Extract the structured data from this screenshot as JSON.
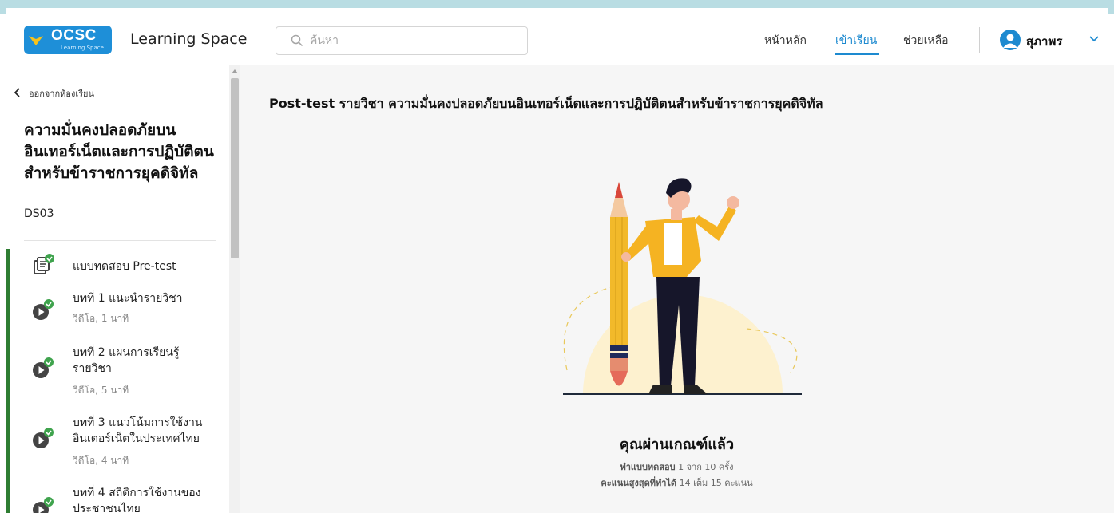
{
  "header": {
    "logo_text": "OCSC",
    "logo_sub": "Learning Space",
    "app_title": "Learning Space",
    "search_placeholder": "ค้นหา",
    "nav": [
      {
        "label": "หน้าหลัก",
        "active": false
      },
      {
        "label": "เข้าเรียน",
        "active": true
      },
      {
        "label": "ช่วยเหลือ",
        "active": false
      }
    ],
    "user_name": "สุภาพร",
    "accent_color": "#1d8ad0"
  },
  "sidebar": {
    "back_label": "ออกจากห้องเรียน",
    "course_title": "ความมั่นคงปลอดภัยบนอินเทอร์เน็ตและการปฏิบัติตนสำหรับข้าราชการยุคดิจิทัล",
    "course_code": "DS03",
    "items": [
      {
        "label": "แบบทดสอบ Pre-test",
        "meta": "",
        "type": "quiz",
        "completed": true
      },
      {
        "label": "บทที่ 1 แนะนำรายวิชา",
        "meta": "วีดีโอ, 1 นาที",
        "type": "video",
        "completed": true
      },
      {
        "label": "บทที่ 2 แผนการเรียนรู้รายวิชา",
        "meta": "วีดีโอ, 5 นาที",
        "type": "video",
        "completed": true
      },
      {
        "label": "บทที่ 3 แนวโน้มการใช้งานอินเตอร์เน็ตในประเทศไทย",
        "meta": "วีดีโอ, 4 นาที",
        "type": "video",
        "completed": true
      },
      {
        "label": "บทที่ 4 สถิติการใช้งานของประชาชนไทย",
        "meta": "",
        "type": "video",
        "completed": true
      }
    ],
    "progress_color": "#2e7d32"
  },
  "main": {
    "test_title": "Post-test รายวิชา ความมั่นคงปลอดภัยบนอินเทอร์เน็ตและการปฏิบัติตนสำหรับข้าราชการยุคดิจิทัล",
    "pass_title": "คุณผ่านเกณฑ์แล้ว",
    "attempts_label": "ทำแบบทดสอบ",
    "attempts_value": "1 จาก 10 ครั้ง",
    "score_label": "คะแนนสูงสุดที่ทำได้",
    "score_value": "14 เต็ม 15 คะแนน"
  }
}
